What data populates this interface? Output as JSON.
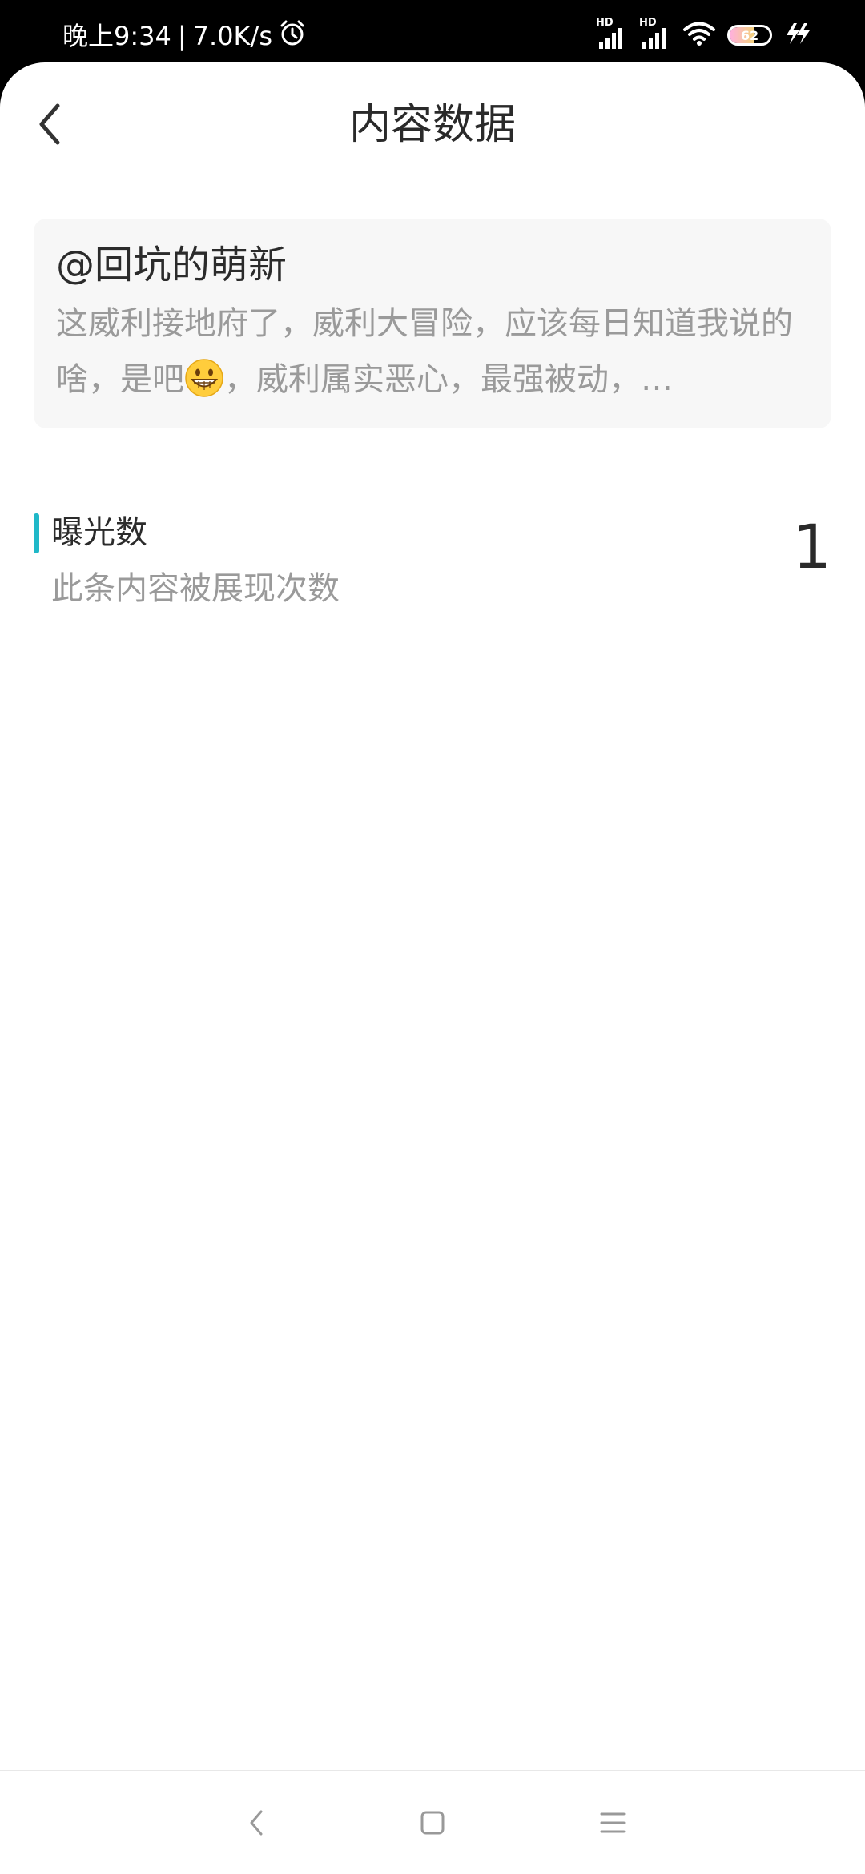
{
  "status_bar": {
    "time": "晚上9:34",
    "separator": "|",
    "net_speed": "7.0K/s",
    "battery_level": "62",
    "battery_fraction": 0.62,
    "signal_label": "HD",
    "icons": [
      "alarm-icon",
      "signal-hd-icon",
      "signal-hd-icon",
      "wifi-icon",
      "battery-icon",
      "charging-icon"
    ]
  },
  "header": {
    "title": "内容数据",
    "back_icon": "chevron-left-icon"
  },
  "post": {
    "author": "@回坑的萌新",
    "text_before_emoji": "这威利接地府了，威利大冒险，应该每日知道我说的啥，是吧",
    "emoji": "grinning-face-emoji",
    "text_after_emoji": "，威利属实恶心，最强被动，…"
  },
  "metric": {
    "label": "曝光数",
    "description": "此条内容被展现次数",
    "value": "1",
    "accent_color": "#20b8c8"
  },
  "nav_bar": {
    "buttons": [
      "back-nav-icon",
      "home-nav-icon",
      "menu-nav-icon"
    ]
  }
}
